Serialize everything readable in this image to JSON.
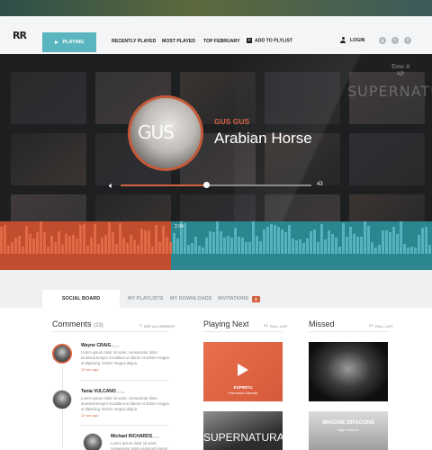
{
  "brand": {
    "logo_text": "RR",
    "accent": "#d3623f",
    "teal": "#5bb5c0"
  },
  "nav": {
    "playing_label": "PLAYING",
    "items": [
      "RECENTLY PLAYED",
      "MOST PLAYED",
      "TOP FEBRUARY"
    ],
    "add_label": "ADD TO PLYLIST",
    "login_label": "LOGIN",
    "social_icons": [
      "google-plus-icon",
      "twitter-icon",
      "facebook-icon"
    ],
    "social_glyphs": [
      "g",
      "t",
      "f"
    ]
  },
  "hero": {
    "corner_logo": "Tone it up",
    "tile_text": "SUPERNATURAL",
    "album_logo_text": "GUS",
    "artist": "GUS GUS",
    "song": "Arabian Horse",
    "volume_value": "43",
    "volume_fraction": 0.45
  },
  "waveform": {
    "time": "2:34",
    "played_fraction": 0.395
  },
  "tabs": {
    "items": [
      "SOCIAL BOARD",
      "MY PLAYLISTS",
      "MY DOWNLOADS",
      "INVITATIONS"
    ],
    "invitations_badge": "3"
  },
  "comments": {
    "title": "Comments",
    "count": "(23)",
    "action": "SEE ALL/NEWEST",
    "items": [
      {
        "name": "Wayne CRAIG",
        "age": "5min",
        "text": "Lorem ipsum dolor sit amet, consectetur dolor eiusmod tempor incididunt ut labore et dolore magna ut dipiscing. Dolore magna aliqua.",
        "time": "12 sec ago"
      },
      {
        "name": "Tania VULCANO",
        "age": "12min",
        "text": "Lorem ipsum dolor sit amet, consectetur dolor eiusmod tempor incididunt ut labore et dolore magna ut dipiscing. Dolore magna aliqua.",
        "time": "12 sec ago"
      },
      {
        "name": "Michael RICHARDS",
        "age": "42min",
        "text": "Lorem ipsum dolor sit amet, consectetur dolor eiusmod tempor incididunt ut labore et dolore magna ut dipiscing.",
        "time": ""
      }
    ]
  },
  "playing_next": {
    "title": "Playing Next",
    "action": "FULL LIST",
    "card1_title": "ESPIRITU",
    "card1_sub": "Francesco Allende",
    "card2_text": "SUPERNATURAL"
  },
  "missed": {
    "title": "Missed",
    "action": "FULL LIST",
    "card2_text": "IMAGINE DRAGONS",
    "card2_sub": "Night Visions"
  }
}
